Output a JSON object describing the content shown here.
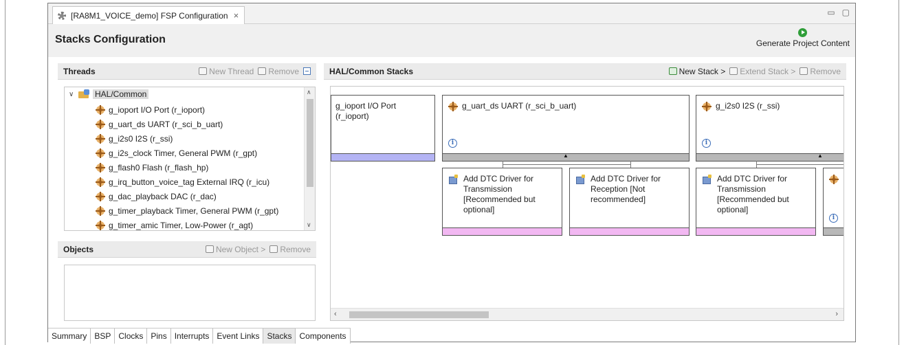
{
  "editor_tab": {
    "title": "[RA8M1_VOICE_demo] FSP Configuration",
    "close_glyph": "×"
  },
  "window_controls": {
    "minimize": "▭",
    "maximize": "▢"
  },
  "header": {
    "title": "Stacks Configuration",
    "generate_label": "Generate Project Content"
  },
  "threads": {
    "title": "Threads",
    "new_thread": "New Thread",
    "remove": "Remove",
    "root": "HAL/Common",
    "items": [
      "g_ioport I/O Port (r_ioport)",
      "g_uart_ds UART (r_sci_b_uart)",
      "g_i2s0 I2S (r_ssi)",
      "g_i2s_clock Timer, General PWM (r_gpt)",
      "g_flash0 Flash (r_flash_hp)",
      "g_irq_button_voice_tag External IRQ (r_icu)",
      "g_dac_playback DAC (r_dac)",
      "g_timer_playback Timer, General PWM (r_gpt)",
      "g_timer_amic Timer, Low-Power (r_agt)"
    ]
  },
  "objects": {
    "title": "Objects",
    "new_object": "New Object >",
    "remove": "Remove"
  },
  "stacks": {
    "title": "HAL/Common Stacks",
    "new_stack": "New Stack >",
    "extend_stack": "Extend Stack >",
    "remove": "Remove",
    "modules": [
      {
        "label": "g_ioport I/O Port (r_ioport)"
      },
      {
        "label": "g_uart_ds UART (r_sci_b_uart)"
      },
      {
        "label": "g_i2s0 I2S (r_ssi)"
      }
    ],
    "sub_modules": [
      {
        "label": "Add DTC Driver for Transmission [Recommended but optional]"
      },
      {
        "label": "Add DTC Driver for Reception [Not recommended]"
      },
      {
        "label": "Add DTC Driver for Transmission [Recommended but optional]"
      }
    ],
    "info_glyph": "i"
  },
  "bottom_tabs": [
    {
      "label": "Summary"
    },
    {
      "label": "BSP"
    },
    {
      "label": "Clocks"
    },
    {
      "label": "Pins"
    },
    {
      "label": "Interrupts"
    },
    {
      "label": "Event Links"
    },
    {
      "label": "Stacks",
      "active": true
    },
    {
      "label": "Components"
    }
  ]
}
